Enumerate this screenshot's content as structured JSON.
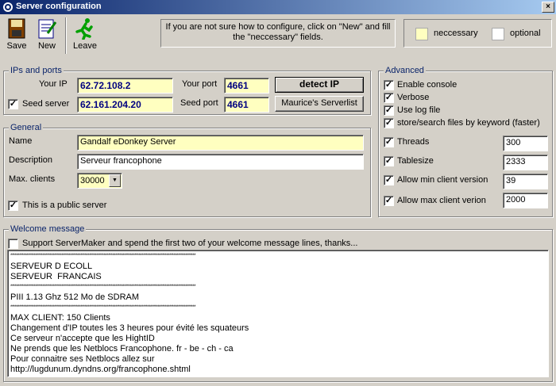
{
  "window": {
    "title": "Server configuration",
    "close": "×"
  },
  "toolbar": {
    "save": "Save",
    "new": "New",
    "leave": "Leave"
  },
  "hint": {
    "text": "If you are not sure how to configure, click on \"New\" and fill the \"neccessary\" fields."
  },
  "legend": {
    "necessary": "neccessary",
    "optional": "optional",
    "necessary_color": "#ffffc0",
    "optional_color": "#ffffff"
  },
  "ips": {
    "title": "IPs and ports",
    "your_ip_label": "Your IP",
    "your_ip": "62.72.108.2",
    "your_port_label": "Your port",
    "your_port": "4661",
    "detect_ip": "detect IP",
    "seed_server_label": "Seed server",
    "seed_server_checked": true,
    "seed_server": "62.161.204.20",
    "seed_port_label": "Seed port",
    "seed_port": "4661",
    "serverlist": "Maurice's Serverlist"
  },
  "general": {
    "title": "General",
    "name_label": "Name",
    "name": "Gandalf eDonkey Server",
    "description_label": "Description",
    "description": "Serveur francophone",
    "max_clients_label": "Max. clients",
    "max_clients": "30000",
    "public_label": "This is a public server",
    "public_checked": true
  },
  "advanced": {
    "title": "Advanced",
    "enable_console": "Enable console",
    "verbose": "Verbose",
    "use_log_file": "Use log file",
    "store_search": "store/search files by keyword (faster)",
    "threads_label": "Threads",
    "threads": "300",
    "tablesize_label": "Tablesize",
    "tablesize": "2333",
    "min_client_label": "Allow min client version",
    "min_client": "39",
    "max_client_label": "Allow max client verion",
    "max_client": "2000"
  },
  "welcome": {
    "title": "Welcome message",
    "support_label": "Support ServerMaker and spend the first two of your welcome message lines, thanks...",
    "separator": "*******************************************************************************************************************************",
    "lines": [
      "",
      "SERVEUR D ECOLL",
      "SERVEUR  FRANCAIS",
      "",
      "PIII 1.13 Ghz 512 Mo de SDRAM",
      "",
      "MAX CLIENT: 150 Clients",
      "Changement d'IP toutes les 3 heures pour évité les squateurs",
      "Ce serveur n'accepte que les HightID",
      "Ne prends que les Netblocs Francophone. fr - be - ch - ca",
      "Pour connaitre ses Netblocs allez sur",
      "http://lugdunum.dyndns.org/francophone.shtml"
    ]
  }
}
